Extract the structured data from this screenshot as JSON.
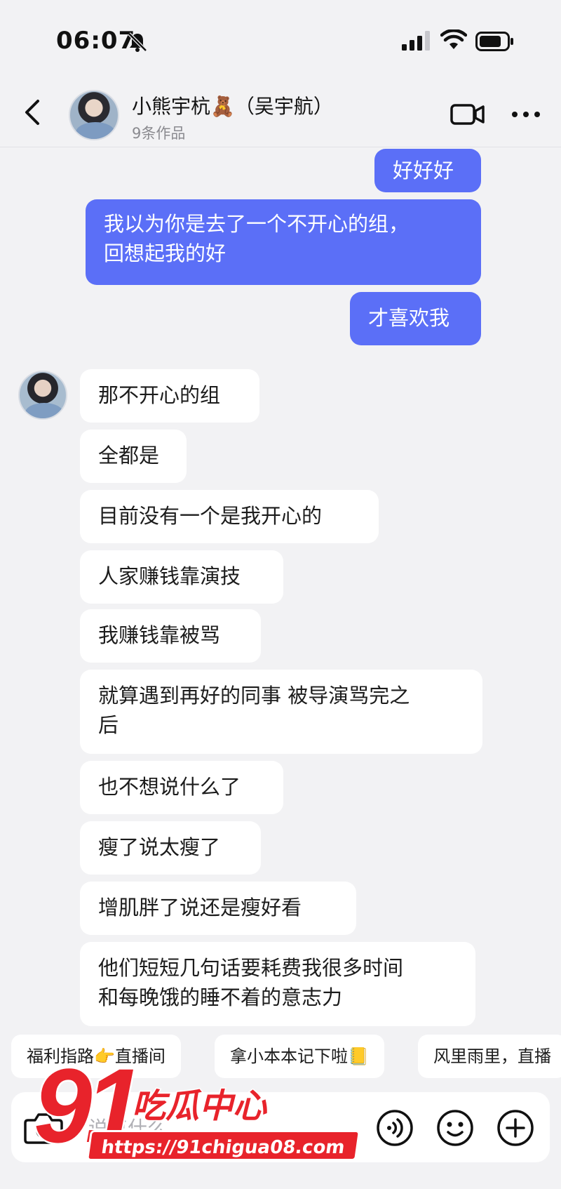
{
  "status_bar": {
    "time": "06:07",
    "icons": [
      "bell-slash-icon",
      "signal-icon",
      "wifi-icon",
      "battery-icon"
    ]
  },
  "header": {
    "contact_name": "小熊宇杭🧸（吴宇航）",
    "subtitle": "9条作品",
    "icons": [
      "back-icon",
      "video-call-icon",
      "more-icon"
    ]
  },
  "messages": [
    {
      "from": "me",
      "text": "好好好"
    },
    {
      "from": "me",
      "text": "我以为你是去了一个不开心的组，\n回想起我的好"
    },
    {
      "from": "me",
      "text": "才喜欢我"
    },
    {
      "from": "them",
      "text": "那不开心的组"
    },
    {
      "from": "them",
      "text": "全都是"
    },
    {
      "from": "them",
      "text": "目前没有一个是我开心的"
    },
    {
      "from": "them",
      "text": "人家赚钱靠演技"
    },
    {
      "from": "them",
      "text": "我赚钱靠被骂"
    },
    {
      "from": "them",
      "text": "就算遇到再好的同事 被导演骂完之\n后"
    },
    {
      "from": "them",
      "text": "也不想说什么了"
    },
    {
      "from": "them",
      "text": "瘦了说太瘦了"
    },
    {
      "from": "them",
      "text": "增肌胖了说还是瘦好看"
    },
    {
      "from": "them",
      "text": "他们短短几句话要耗费我很多时间\n和每晚饿的睡不着的意志力"
    }
  ],
  "quick_replies": [
    "福利指路👉直播间",
    "拿小本本记下啦📒",
    "风里雨里，直播"
  ],
  "input": {
    "placeholder": "说点什么...",
    "icons": [
      "camera-icon",
      "voice-icon",
      "emoji-icon",
      "plus-icon"
    ]
  },
  "watermark": {
    "number": "91",
    "name": "吃瓜中心",
    "url": "https://91chigua08.com"
  },
  "colors": {
    "outgoing_bubble": "#5b6ff7",
    "incoming_bubble": "#ffffff",
    "background": "#f2f2f4",
    "watermark_red": "#e8232b"
  }
}
